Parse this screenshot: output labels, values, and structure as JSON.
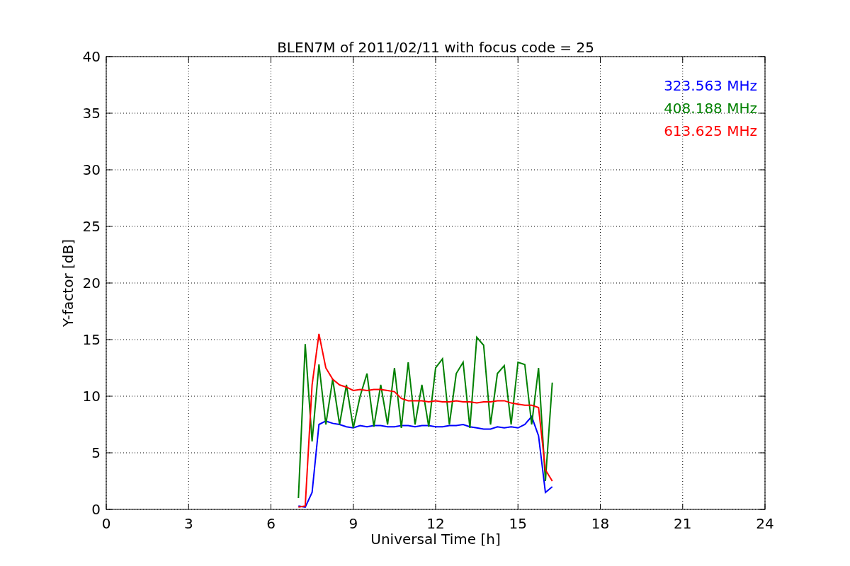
{
  "figure": {
    "chart_data": {
      "type": "line",
      "title": "BLEN7M of 2011/02/11 with focus code = 25",
      "xlabel": "Universal Time [h]",
      "ylabel": "Y-factor [dB]",
      "x": [
        7,
        7.25,
        7.5,
        7.75,
        8,
        8.25,
        8.5,
        8.75,
        9,
        9.25,
        9.5,
        9.75,
        10,
        10.25,
        10.5,
        10.75,
        11,
        11.25,
        11.5,
        11.75,
        12,
        12.25,
        12.5,
        12.75,
        13,
        13.25,
        13.5,
        13.75,
        14,
        14.25,
        14.5,
        14.75,
        15,
        15.25,
        15.5,
        15.75,
        16,
        16.25
      ],
      "series": [
        {
          "name": "323.563 MHz",
          "color": "#0000ff",
          "values": [
            0.3,
            0.2,
            1.5,
            7.5,
            7.8,
            7.6,
            7.5,
            7.3,
            7.2,
            7.4,
            7.3,
            7.4,
            7.4,
            7.3,
            7.3,
            7.4,
            7.4,
            7.3,
            7.4,
            7.4,
            7.3,
            7.3,
            7.4,
            7.4,
            7.5,
            7.3,
            7.2,
            7.1,
            7.1,
            7.3,
            7.2,
            7.3,
            7.2,
            7.5,
            8.2,
            6.5,
            1.5,
            2.0
          ]
        },
        {
          "name": "408.188 MHz",
          "color": "#008000",
          "values": [
            1,
            14.6,
            6,
            12.8,
            7.5,
            11.5,
            7.5,
            11,
            7.2,
            10,
            12,
            7.3,
            11,
            7.5,
            12.5,
            7.2,
            13,
            7.5,
            11,
            7.3,
            12.5,
            13.3,
            7.5,
            12,
            13,
            7.2,
            15.2,
            14.5,
            7.5,
            12,
            12.7,
            7.5,
            13,
            12.8,
            7.5,
            12.5,
            2.5,
            11.2
          ]
        },
        {
          "name": "613.625 MHz",
          "color": "#ff0000",
          "values": [
            0.2,
            0.3,
            11,
            15.5,
            12.5,
            11.5,
            11,
            10.8,
            10.5,
            10.6,
            10.5,
            10.6,
            10.6,
            10.5,
            10.4,
            9.8,
            9.6,
            9.6,
            9.6,
            9.5,
            9.6,
            9.5,
            9.5,
            9.6,
            9.5,
            9.5,
            9.4,
            9.5,
            9.5,
            9.6,
            9.6,
            9.4,
            9.3,
            9.2,
            9.2,
            9.0,
            3.5,
            2.5
          ]
        }
      ],
      "xlim": [
        0,
        24
      ],
      "ylim": [
        0,
        40
      ],
      "xticks": [
        0,
        3,
        6,
        9,
        12,
        15,
        18,
        21,
        24
      ],
      "yticks": [
        0,
        5,
        10,
        15,
        20,
        25,
        30,
        35,
        40
      ],
      "grid": true
    }
  }
}
